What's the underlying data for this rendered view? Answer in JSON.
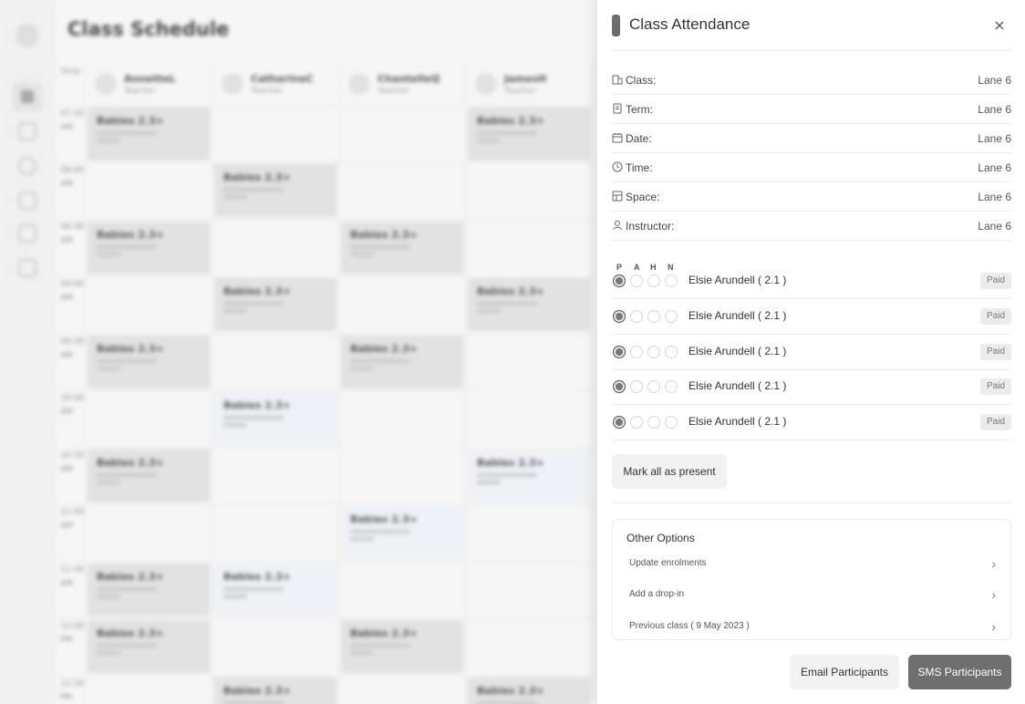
{
  "schedule": {
    "title": "Class Schedule",
    "time_header": "Time",
    "times": [
      "07:30 AM",
      "08:00 AM",
      "08:30 AM",
      "09:00 AM",
      "09:30 AM",
      "10:00 AM",
      "10:30 AM",
      "11:00 AM",
      "11:30 AM",
      "12:00 PM",
      "12:30 PM"
    ],
    "teachers": [
      {
        "name": "AnnetteL",
        "role": "Teacher"
      },
      {
        "name": "CatherineC",
        "role": "Teacher"
      },
      {
        "name": "ChantelleQ",
        "role": "Teacher"
      },
      {
        "name": "JamesH",
        "role": "Teacher"
      }
    ],
    "class_label": "Babies 2.3+",
    "class_sub": "Weekend Lane 18",
    "class_count": "7 of 7"
  },
  "panel": {
    "title": "Class Attendance",
    "close_label": "×",
    "info": [
      {
        "icon": "building-icon",
        "label": "Class:",
        "value": "Lane 6"
      },
      {
        "icon": "document-icon",
        "label": "Term:",
        "value": "Lane 6"
      },
      {
        "icon": "calendar-icon",
        "label": "Date:",
        "value": "Lane 6"
      },
      {
        "icon": "clock-icon",
        "label": "Time:",
        "value": "Lane 6"
      },
      {
        "icon": "space-icon",
        "label": "Space:",
        "value": "Lane 6"
      },
      {
        "icon": "person-icon",
        "label": "Instructor:",
        "value": "Lane 6"
      }
    ],
    "attendance_headers": [
      "P",
      "A",
      "H",
      "N"
    ],
    "participants": [
      {
        "name": "Elsie Arundell  ( 2.1 )",
        "status": "Paid"
      },
      {
        "name": "Elsie Arundell  ( 2.1 )",
        "status": "Paid"
      },
      {
        "name": "Elsie Arundell  ( 2.1 )",
        "status": "Paid"
      },
      {
        "name": "Elsie Arundell  ( 2.1 )",
        "status": "Paid"
      },
      {
        "name": "Elsie Arundell  ( 2.1 )",
        "status": "Paid"
      }
    ],
    "mark_all_label": "Mark all as present",
    "other_options": {
      "title": "Other Options",
      "items": [
        "Update enrolments",
        "Add a drop-in",
        "Previous class ( 9 May 2023 )"
      ],
      "chevron": "›"
    },
    "email_label": "Email Participants",
    "sms_label": "SMS Participants"
  }
}
